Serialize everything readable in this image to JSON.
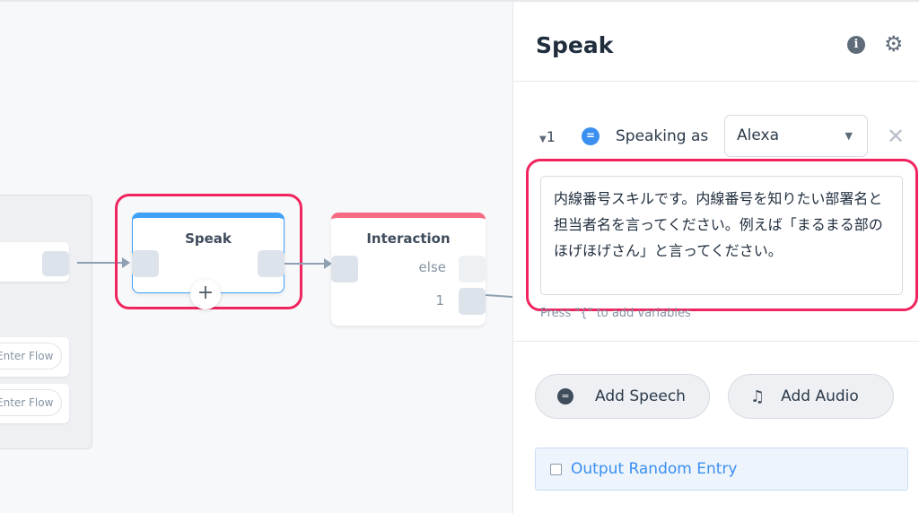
{
  "canvas": {
    "group": {
      "pill1": "Enter Flow",
      "pill2": "Enter Flow"
    },
    "speak_node": {
      "title": "Speak",
      "add_icon": "plus-icon",
      "color": "#3fa2f7"
    },
    "interaction_node": {
      "title": "Interaction",
      "else_label": "else",
      "choice_label": "1",
      "color": "#f76a83"
    }
  },
  "panel": {
    "title": "Speak",
    "info_icon": "info-icon",
    "gear_icon": "gear-icon",
    "entry": {
      "index": "1",
      "icon": "speech-bubble-icon",
      "speaking_as_label": "Speaking as",
      "voice": "Alexa",
      "text": "内線番号スキルです。内線番号を知りたい部署名と担当者名を言ってください。例えば「まるまる部のほげほげさん」と言ってください。",
      "hint": "Press \"{\" to add variables"
    },
    "add_speech": "Add Speech",
    "add_audio": "Add Audio",
    "random_entry": "Output Random Entry",
    "highlight_color": "#f0245e"
  }
}
